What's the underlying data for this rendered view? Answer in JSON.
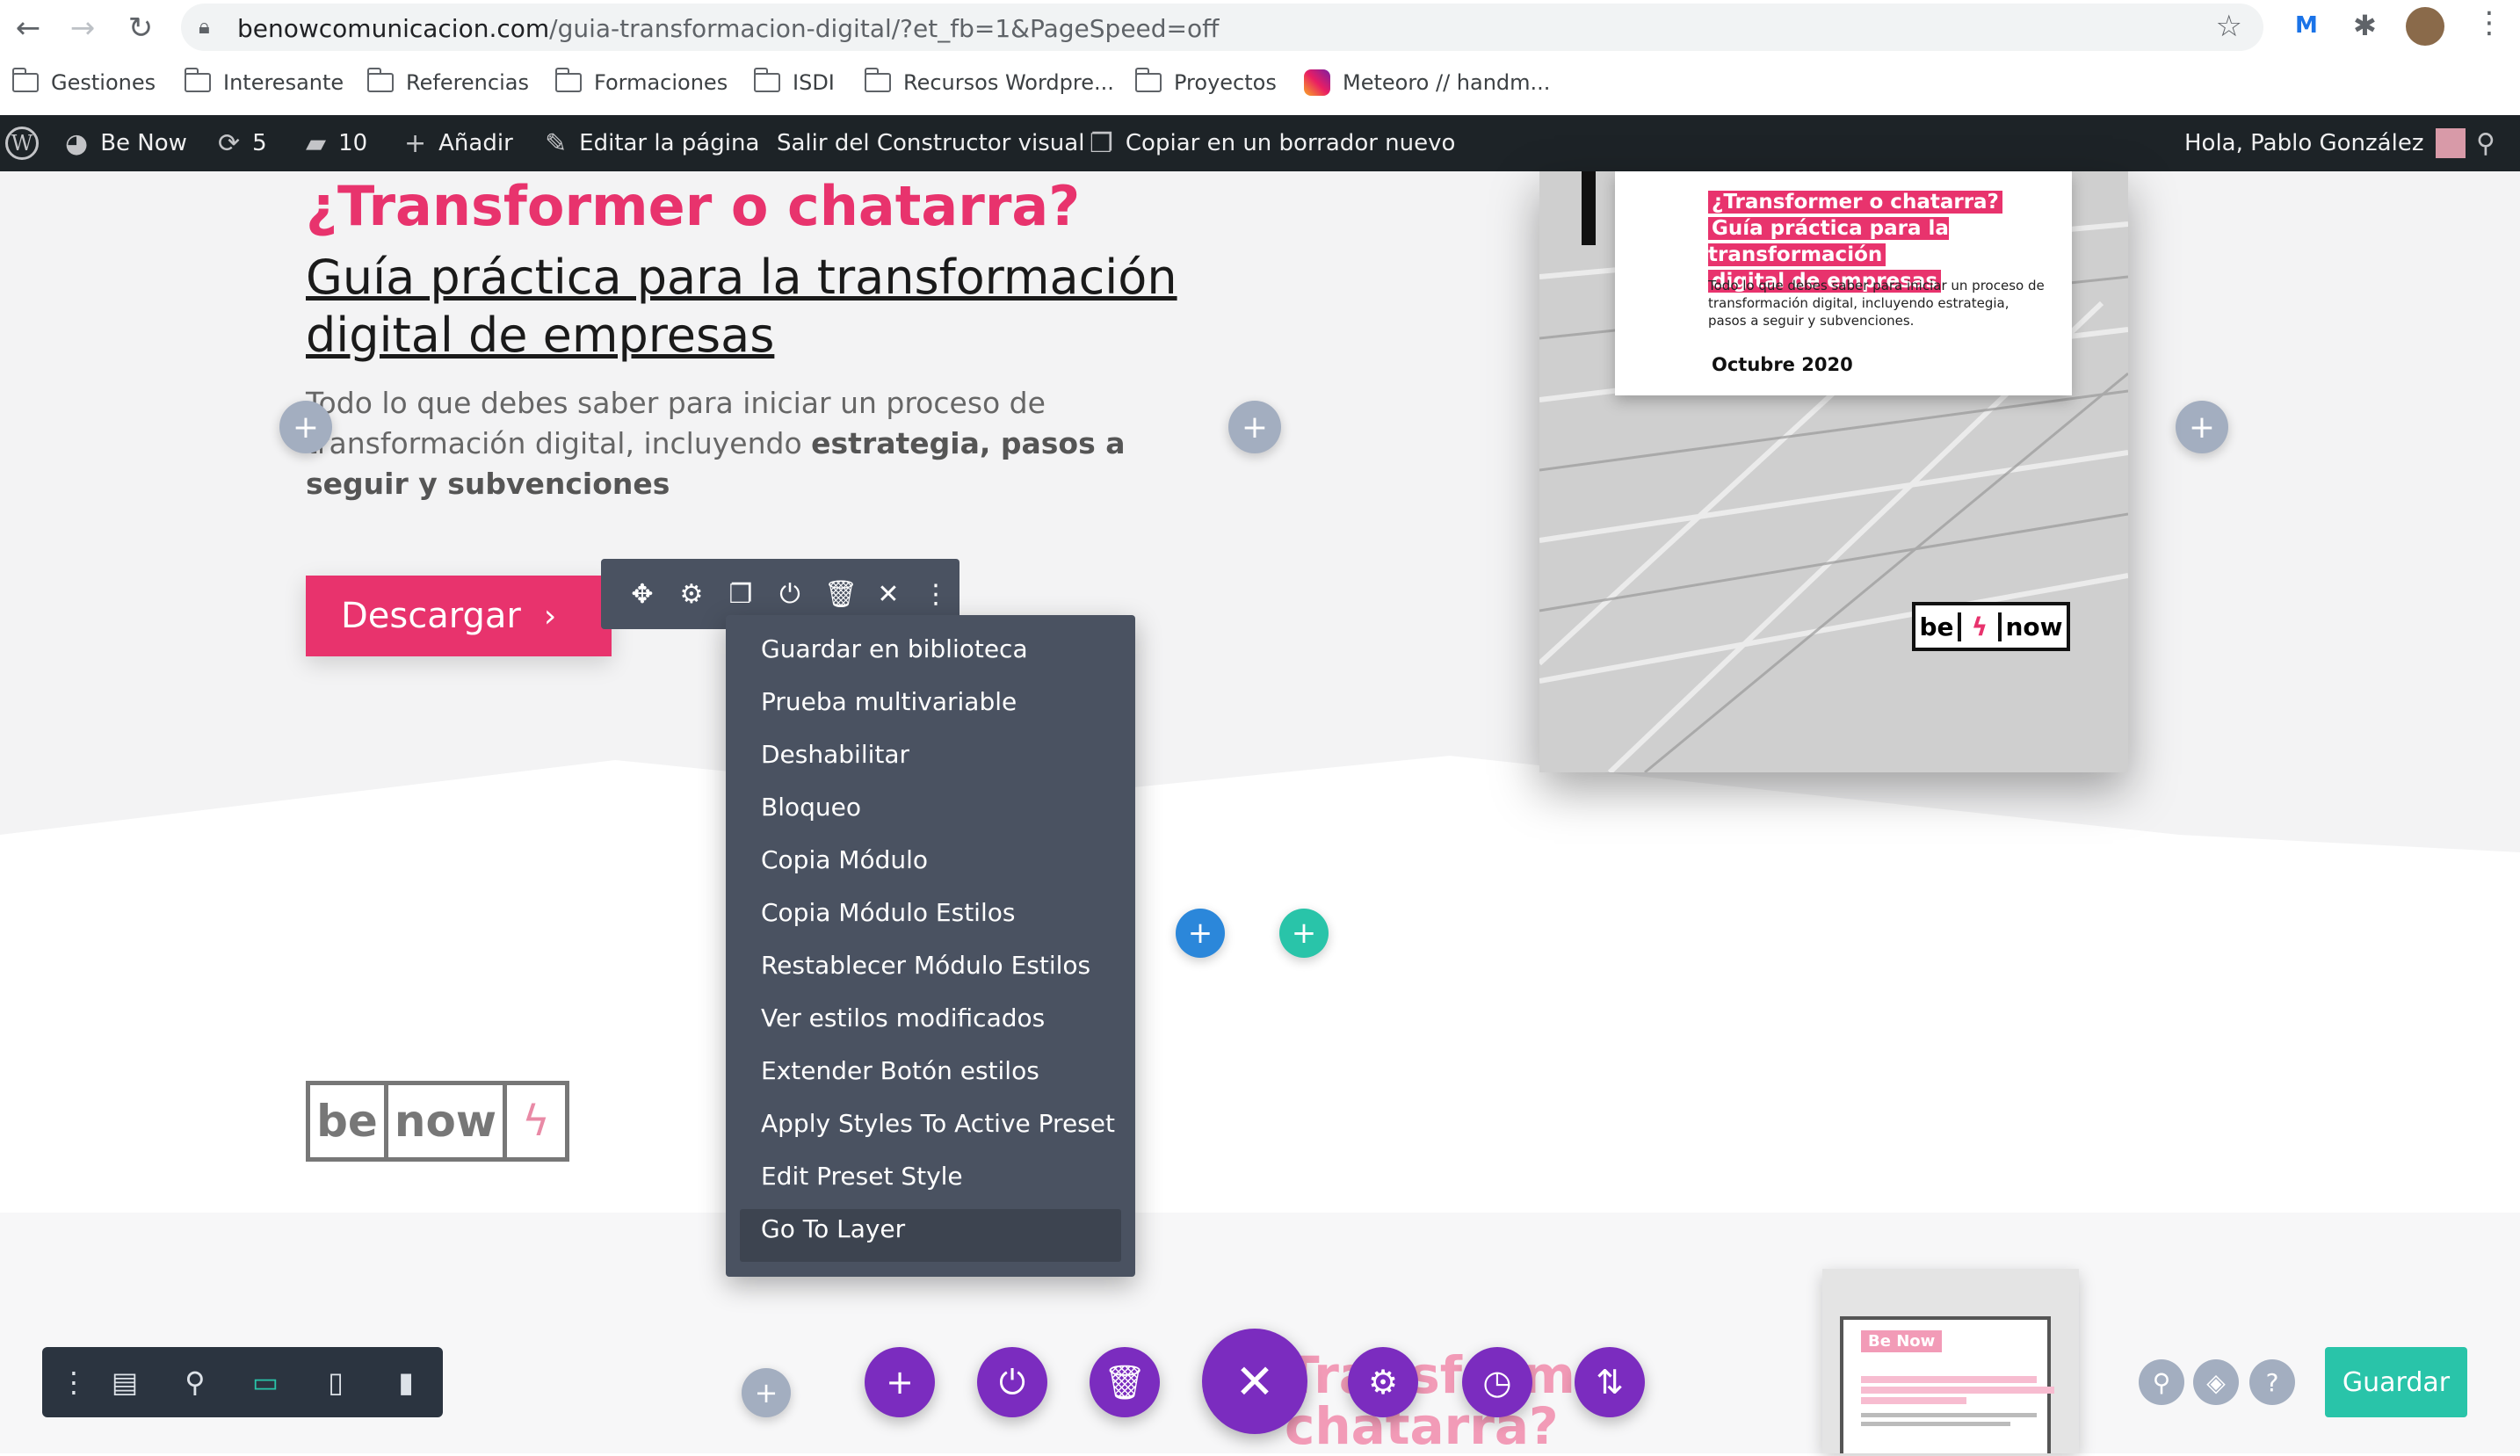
{
  "browser": {
    "url_host": "benowcomunicacion.com",
    "url_path": "/guia-transformacion-digital/?et_fb=1&PageSpeed=off",
    "bookmarks": [
      "Gestiones",
      "Interesante",
      "Referencias",
      "Formaciones",
      "ISDI",
      "Recursos Wordpre...",
      "Proyectos",
      "Meteoro // handm..."
    ]
  },
  "adminbar": {
    "site": "Be Now",
    "updates": "5",
    "comments": "10",
    "add": "Añadir",
    "edit": "Editar la página",
    "exit": "Salir del Constructor visual",
    "copy": "Copiar en un borrador nuevo",
    "greeting": "Hola, Pablo González"
  },
  "hero": {
    "title": "¿Transformer o chatarra?",
    "subtitle": "Guía práctica para la transformación digital de empresas",
    "desc_plain": "Todo lo que debes saber para iniciar un proceso de transformación digital, incluyendo ",
    "desc_bold": "estrategia, pasos a seguir y subvenciones",
    "button": "Descargar",
    "button_arrow": "›"
  },
  "book": {
    "line1": "¿Transformer o chatarra?",
    "line2": "Guía práctica para la transformación",
    "line3": "digital de empresas",
    "body": "Todo lo que debes saber para iniciar un proceso de transformación digital, incluyendo estrategia, pasos a seguir y subvenciones.",
    "date": "Octubre 2020",
    "logo_be": "be",
    "logo_now": "now"
  },
  "logo2": {
    "be": "be",
    "now": "now"
  },
  "context_menu": {
    "items": [
      "Guardar en biblioteca",
      "Prueba multivariable",
      "Deshabilitar",
      "Bloqueo",
      "Copia Módulo",
      "Copia Módulo Estilos",
      "Restablecer Módulo Estilos",
      "Ver estilos modificados",
      "Extender Botón estilos",
      "Apply Styles To Active Preset",
      "Edit Preset Style",
      "Go To Layer"
    ],
    "active_index": 11
  },
  "bottom": {
    "ghost_title_1": "Transforme",
    "ghost_title_2": "chatarra?",
    "thumb_badge": "Be Now",
    "save": "Guardar"
  },
  "colors": {
    "accent": "#e8336d",
    "builder_purple": "#7b2cbf",
    "save_green": "#29c4a9",
    "menu_bg": "#4a5261"
  }
}
